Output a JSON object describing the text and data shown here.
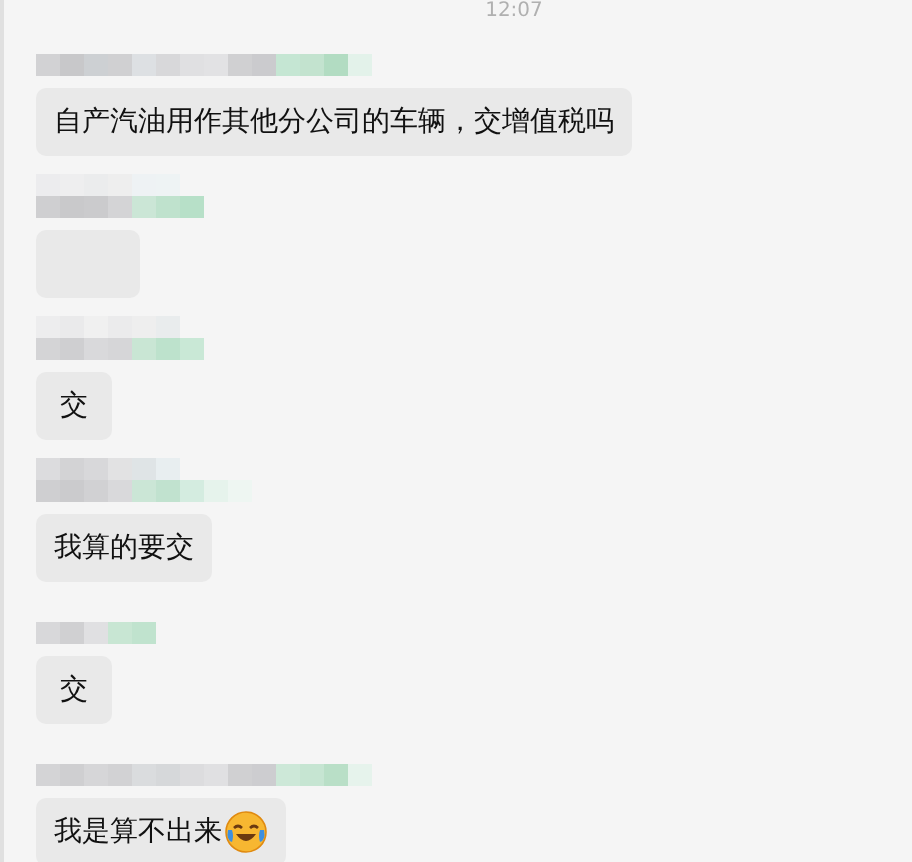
{
  "timestamp": "12:07",
  "messages": [
    {
      "kind": "text",
      "text": "自产汽油用作其他分公司的车辆，交增值税吗",
      "emoji": false
    },
    {
      "kind": "blank"
    },
    {
      "kind": "text",
      "text": "交",
      "emoji": false
    },
    {
      "kind": "text",
      "text": "我算的要交",
      "emoji": false
    },
    {
      "kind": "text",
      "text": "交",
      "emoji": false
    },
    {
      "kind": "text",
      "text": "我是算不出来",
      "emoji": true
    }
  ]
}
